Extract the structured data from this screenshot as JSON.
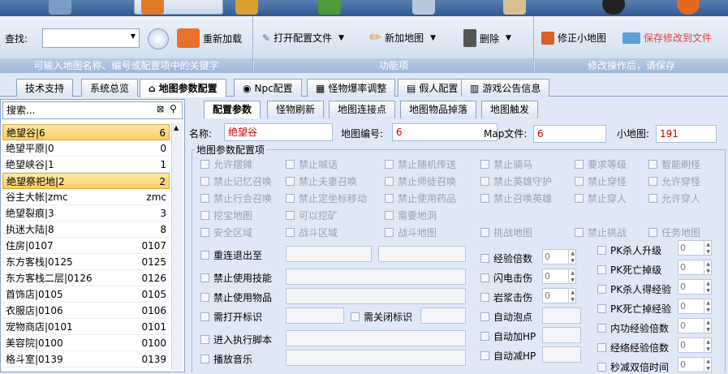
{
  "ribbon": {
    "search_label": "查找:",
    "reload_label": "重新加载",
    "search_caption": "可输入地图名称、编号或配置项中的关键字",
    "open_config_label": "打开配置文件",
    "add_map_label": "新加地图",
    "delete_label": "删除",
    "func_caption": "功能项",
    "fix_minimap_label": "修正小地图",
    "save_label": "保存修改到文件",
    "modify_caption": "修改操作后，请保存"
  },
  "tabs": [
    "技术支持",
    "系统总览",
    "地图参数配置",
    "Npc配置",
    "怪物爆率调整",
    "假人配置",
    "游戏公告信息"
  ],
  "left": {
    "search_placeholder": "搜索...",
    "items": [
      {
        "name": "绝望谷|6",
        "code": "6"
      },
      {
        "name": "绝望平原|0",
        "code": "0"
      },
      {
        "name": "绝望峡谷|1",
        "code": "1"
      },
      {
        "name": "绝望祭祀地|2",
        "code": "2"
      },
      {
        "name": "谷主大帐|zmc",
        "code": "zmc"
      },
      {
        "name": "绝望裂痕|3",
        "code": "3"
      },
      {
        "name": "执迷大陆|8",
        "code": "8"
      },
      {
        "name": "住房|0107",
        "code": "0107"
      },
      {
        "name": "东方客栈|0125",
        "code": "0125"
      },
      {
        "name": "东方客栈二层|0126",
        "code": "0126"
      },
      {
        "name": "首饰店|0105",
        "code": "0105"
      },
      {
        "name": "衣服店|0106",
        "code": "0106"
      },
      {
        "name": "宠物商店|0101",
        "code": "0101"
      },
      {
        "name": "美容院|0100",
        "code": "0100"
      },
      {
        "name": "格斗室|0139",
        "code": "0139"
      }
    ]
  },
  "subtabs": [
    "配置参数",
    "怪物刷新",
    "地图连接点",
    "地图物品掉落",
    "地图触发"
  ],
  "form": {
    "name_label": "名称:",
    "name_value": "绝望谷",
    "id_label": "地图编号:",
    "id_value": "6",
    "map_label": "Map文件:",
    "map_value": "6",
    "mini_label": "小地图:",
    "mini_value": "191",
    "group_caption": "地图参数配置项"
  },
  "checks": {
    "r1": [
      "允许摆摊",
      "禁止喊话",
      "禁止随机传送",
      "禁止骑马",
      "要求等级",
      "智能刷怪"
    ],
    "r2": [
      "禁止记忆召唤",
      "禁止夫妻召唤",
      "禁止师徒召唤",
      "禁止英雄守护",
      "禁止穿怪",
      "允许穿怪"
    ],
    "r3": [
      "禁止行会召唤",
      "禁止定坐标移动",
      "禁止使用药品",
      "禁止召唤英雄",
      "禁止穿人",
      "允许穿人"
    ],
    "r4": [
      "挖宝地图",
      "可以挖矿",
      "需要地洞"
    ],
    "r5": [
      "安全区域",
      "战斗区域",
      "战斗地图",
      "挑战地图",
      "禁止挑战",
      "任务地图"
    ],
    "left": [
      "重连退出至",
      "禁止使用技能",
      "禁止使用物品",
      "需打开标识",
      "需关闭标识",
      "进入执行脚本",
      "播放音乐"
    ],
    "mid": [
      "经验倍数",
      "闪电击伤",
      "岩浆击伤",
      "自动泡点",
      "自动加HP",
      "自动减HP"
    ],
    "right": [
      "PK杀人升级",
      "PK死亡掉级",
      "PK杀人得经验",
      "PK死亡掉经验",
      "内功经验倍数",
      "经络经验倍数",
      "秒减双倍时间"
    ]
  },
  "spin_value": "0"
}
